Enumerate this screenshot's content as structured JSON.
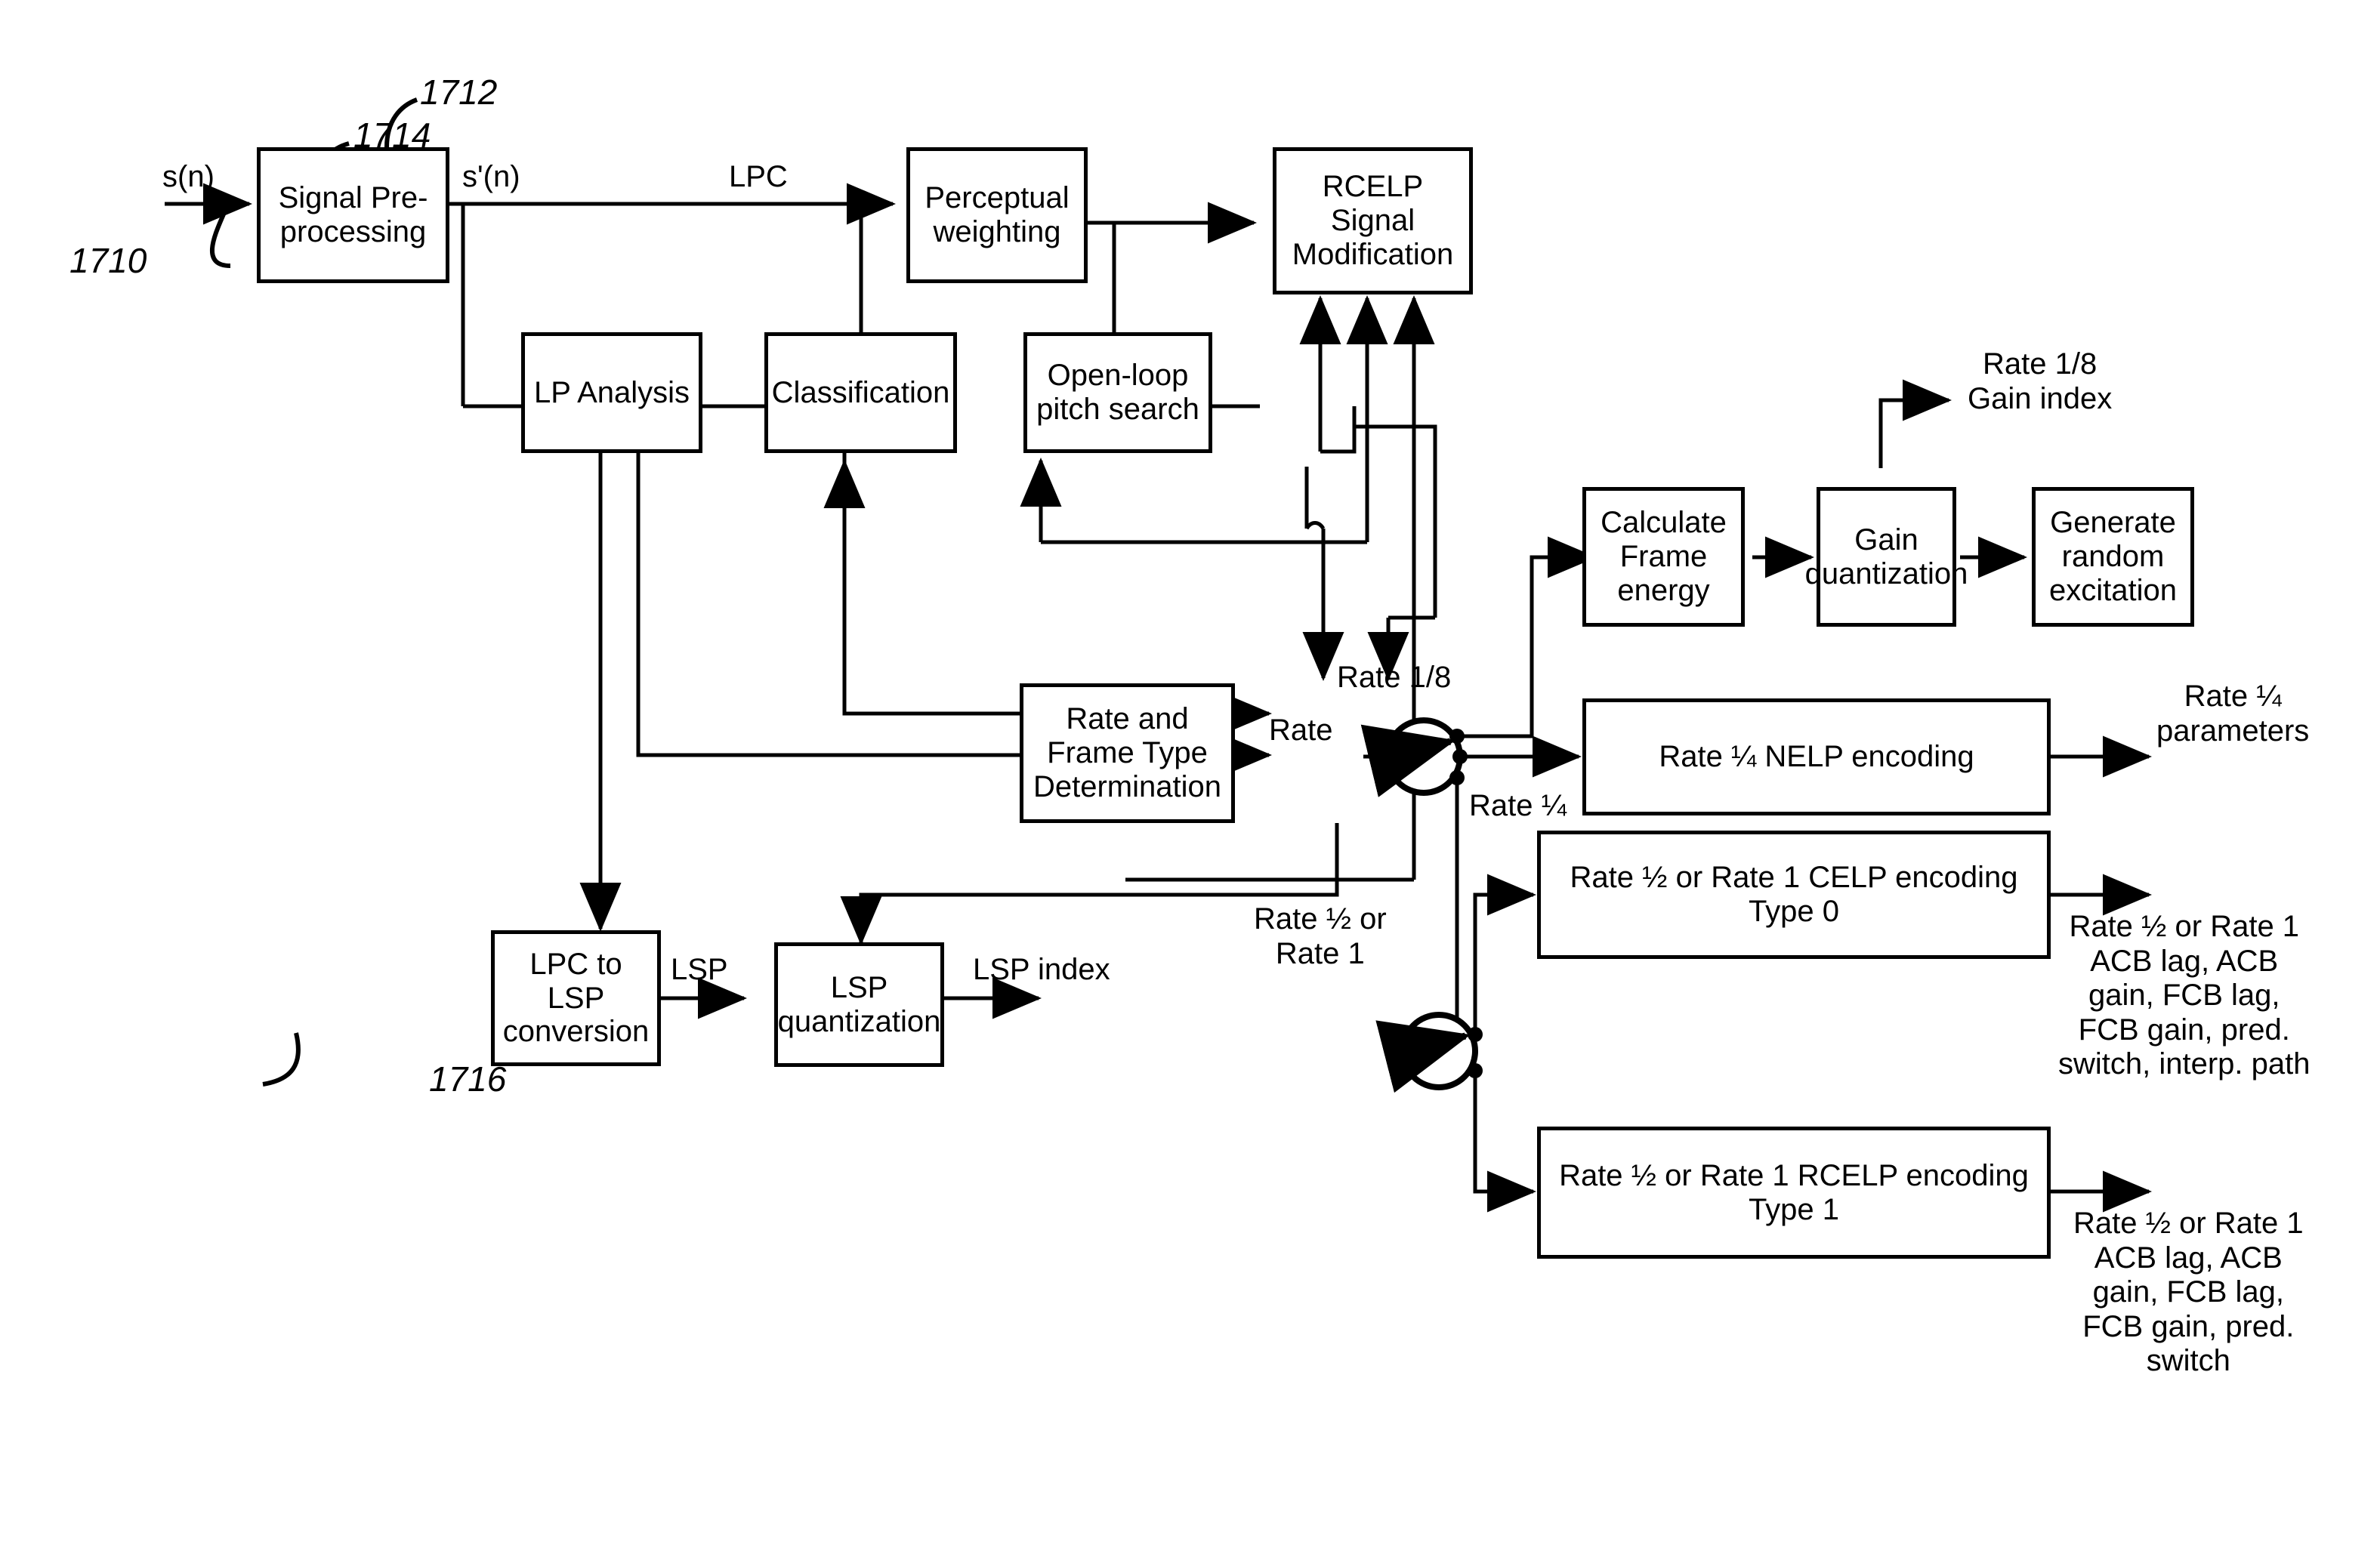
{
  "figure": {
    "type": "block-diagram",
    "subject": "Variable-rate speech encoder signal flow"
  },
  "reference_numerals": [
    {
      "id": "ref-1710",
      "text": "1710"
    },
    {
      "id": "ref-1712",
      "text": "1712"
    },
    {
      "id": "ref-1714",
      "text": "1714"
    },
    {
      "id": "ref-1716",
      "text": "1716"
    }
  ],
  "blocks": {
    "signal_preprocessing": {
      "line1": "Signal Pre-",
      "line2": "processing"
    },
    "perceptual_weighting": {
      "line1": "Perceptual",
      "line2": "weighting"
    },
    "rcelp_signal_modification": {
      "line1": "RCELP",
      "line2": "Signal",
      "line3": "Modification"
    },
    "lp_analysis": {
      "line1": "LP Analysis"
    },
    "classification": {
      "line1": "Classification"
    },
    "open_loop_pitch_search": {
      "line1": "Open-loop",
      "line2": "pitch search"
    },
    "calculate_frame_energy": {
      "line1": "Calculate",
      "line2": "Frame",
      "line3": "energy"
    },
    "gain_quantization": {
      "line1": "Gain",
      "line2": "quantization"
    },
    "generate_random_excitation": {
      "line1": "Generate",
      "line2": "random",
      "line3": "excitation"
    },
    "rate_and_frame_type_determination": {
      "line1": "Rate and",
      "line2": "Frame Type",
      "line3": "Determination"
    },
    "lpc_to_lsp_conversion": {
      "line1": "LPC to LSP",
      "line2": "conversion"
    },
    "lsp_quantization": {
      "line1": "LSP",
      "line2": "quantization"
    },
    "nelp_encoding": {
      "line1": "Rate ¼ NELP encoding"
    },
    "celp_encoding_type0": {
      "line1": "Rate ½ or Rate 1 CELP encoding",
      "line2": "Type 0"
    },
    "rcelp_encoding_type1": {
      "line1": "Rate ½ or Rate 1 RCELP encoding",
      "line2": "Type 1"
    }
  },
  "signal_labels": {
    "input_sn": "s(n)",
    "preprocessed_sn": "s'(n)",
    "lpc": "LPC",
    "lsp": "LSP",
    "lsp_index": "LSP index",
    "rate": "Rate",
    "rate_one_eighth_switch": "Rate 1/8",
    "rate_one_quarter_switch": "Rate ¼",
    "rate_half_or_one": "Rate ½ or\nRate 1",
    "rate_one_eighth_gain_index": "Rate 1/8\nGain index",
    "rate_one_quarter_parameters": "Rate ¼\nparameters",
    "celp_output_params": "Rate ½ or Rate 1\nACB lag, ACB\ngain, FCB lag,\nFCB gain, pred.\nswitch, interp. path",
    "rcelp_output_params": "Rate ½ or Rate 1\nACB lag, ACB\ngain, FCB lag,\nFCB gain, pred.\nswitch"
  },
  "style": {
    "stroke": "#000000",
    "background": "#ffffff",
    "line_width": 5
  }
}
